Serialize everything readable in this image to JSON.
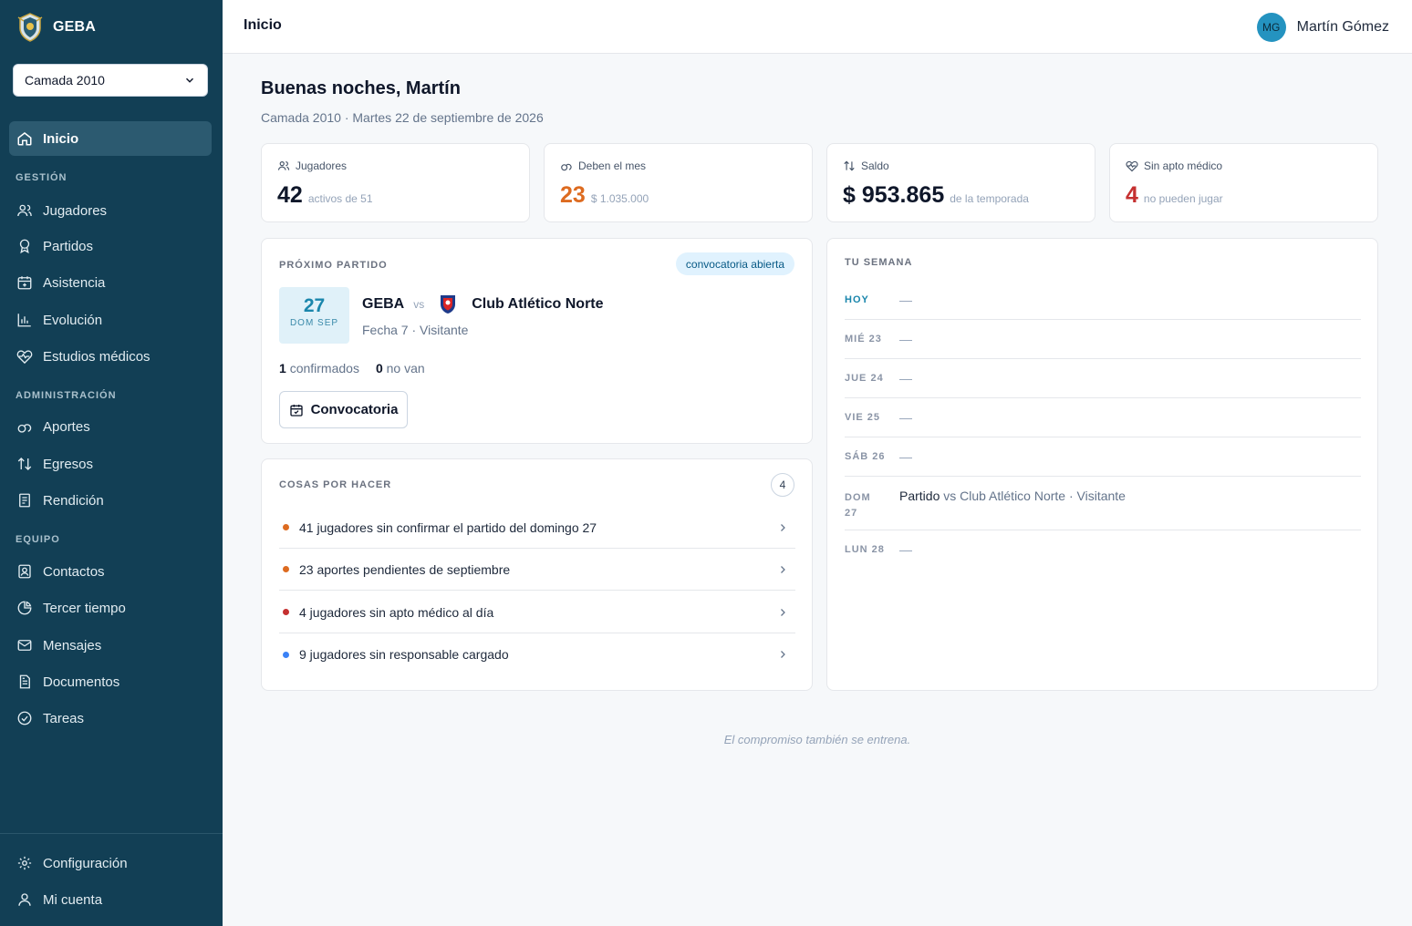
{
  "app": {
    "brand": "GEBA"
  },
  "sidebar": {
    "team_select": "Camada 2010",
    "home": "Inicio",
    "section_gestion": "GESTIÓN",
    "jugadores": "Jugadores",
    "partidos": "Partidos",
    "asistencia": "Asistencia",
    "evolucion": "Evolución",
    "estudios": "Estudios médicos",
    "section_admin": "ADMINISTRACIÓN",
    "aportes": "Aportes",
    "egresos": "Egresos",
    "rendicion": "Rendición",
    "section_equipo": "EQUIPO",
    "contactos": "Contactos",
    "tercer_tiempo": "Tercer tiempo",
    "mensajes": "Mensajes",
    "documentos": "Documentos",
    "tareas": "Tareas",
    "configuracion": "Configuración",
    "mi_cuenta": "Mi cuenta"
  },
  "topbar": {
    "title": "Inicio",
    "user_initials": "MG",
    "user_name": "Martín Gómez"
  },
  "main": {
    "greeting": "Buenas noches, Martín",
    "subtitle": "Camada 2010 · Martes 22 de septiembre de 2026"
  },
  "stats": {
    "jugadores": {
      "label": "Jugadores",
      "value": "42",
      "note": "activos de 51"
    },
    "deben": {
      "label": "Deben el mes",
      "value": "23",
      "note": "$ 1.035.000"
    },
    "saldo": {
      "label": "Saldo",
      "value": "$ 953.865",
      "note": "de la temporada"
    },
    "apto": {
      "label": "Sin apto médico",
      "value": "4",
      "note": "no pueden jugar"
    }
  },
  "next_match": {
    "title": "PRÓXIMO PARTIDO",
    "badge": "convocatoria abierta",
    "day": "27",
    "month": "DOM SEP",
    "home": "GEBA",
    "vs": "vs",
    "away": "Club Atlético Norte",
    "detail": "Fecha 7 · Visitante",
    "confirmed_count": "1",
    "confirmed_label": "confirmados",
    "not_going_count": "0",
    "not_going_label": "no van",
    "button": "Convocatoria"
  },
  "todos": {
    "title": "COSAS POR HACER",
    "count": "4",
    "items": [
      {
        "text": "41 jugadores sin confirmar el partido del domingo 27",
        "color": "#dd6b20"
      },
      {
        "text": "23 aportes pendientes de septiembre",
        "color": "#dd6b20"
      },
      {
        "text": "4 jugadores sin apto médico al día",
        "color": "#c53030"
      },
      {
        "text": "9 jugadores sin responsable cargado",
        "color": "#3b82f6"
      }
    ]
  },
  "week": {
    "title": "TU SEMANA",
    "rows": [
      {
        "day": "HOY",
        "text": "—"
      },
      {
        "day": "MIÉ 23",
        "text": "—"
      },
      {
        "day": "JUE 24",
        "text": "—"
      },
      {
        "day": "VIE 25",
        "text": "—"
      },
      {
        "day": "SÁB 26",
        "text": "—"
      },
      {
        "day": "DOM 27",
        "event": "Partido",
        "event_rest": "vs Club Atlético Norte · Visitante"
      },
      {
        "day": "LUN 28",
        "text": "—"
      }
    ]
  },
  "footer": {
    "quote": "El compromiso también se entrena."
  },
  "colors": {
    "sidebar": "#123f55",
    "accent": "#1a86ac",
    "orange": "#dd6b20",
    "red": "#c53030",
    "blue": "#3b82f6"
  }
}
